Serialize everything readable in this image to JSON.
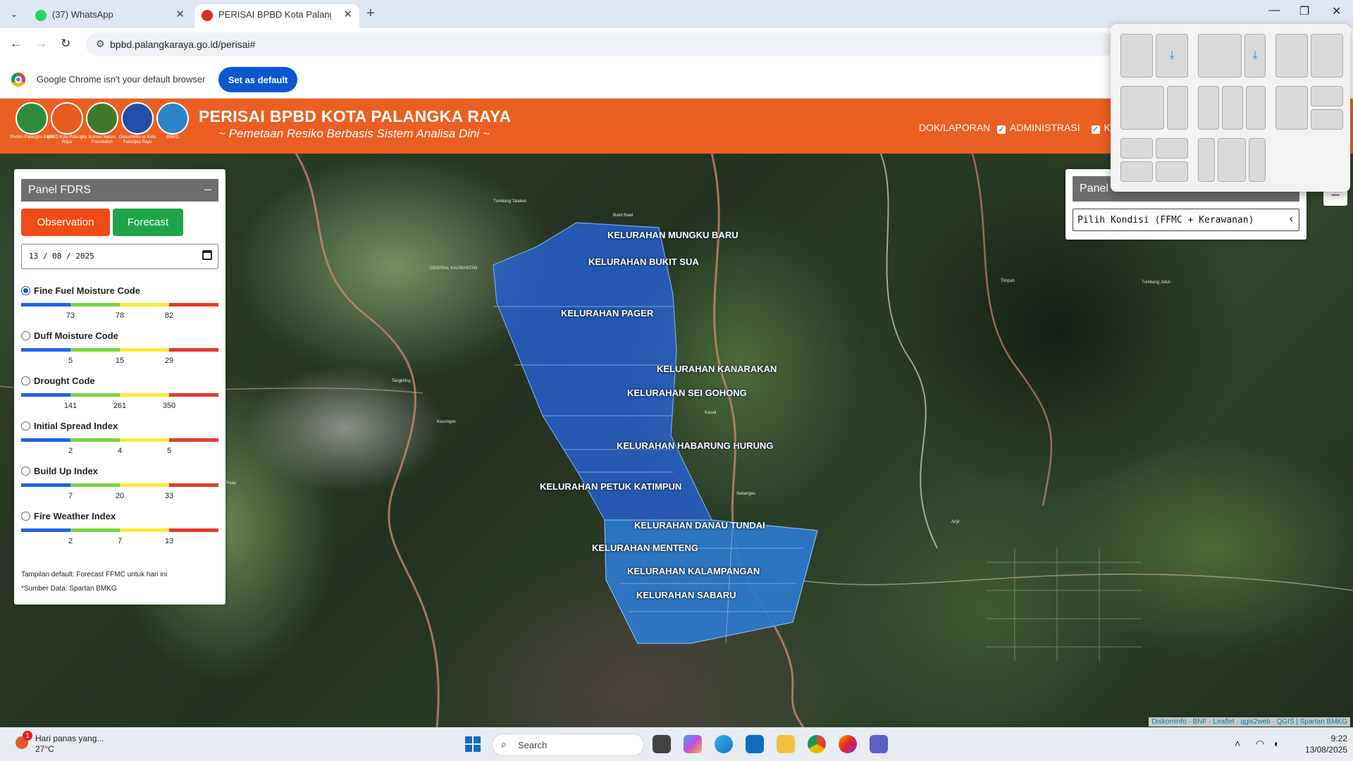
{
  "browser": {
    "tabs": [
      {
        "title": "(37) WhatsApp",
        "active": false
      },
      {
        "title": "PERISAI BPBD Kota Palangka Ra",
        "active": true
      }
    ],
    "url": "bpbd.palangkaraya.go.id/perisai#",
    "infobar": {
      "message": "Google Chrome isn't your default browser",
      "button": "Set as default"
    }
  },
  "header": {
    "title": "PERISAI BPBD KOTA PALANGKA RAYA",
    "subtitle": "~ Pemetaan Resiko Berbasis Sistem Analisa Dini ~",
    "logos": [
      {
        "caption": "Pemko Palangka Raya",
        "color": "#2e8b3e"
      },
      {
        "caption": "BPBD Kota Palangka Raya",
        "color": "#e65a1e"
      },
      {
        "caption": "Borneo Nature Foundation",
        "color": "#3f7a2a"
      },
      {
        "caption": "Diskominfo-sp Kota Palangka Raya",
        "color": "#1f4fa8"
      },
      {
        "caption": "BMKG",
        "color": "#2a86c8"
      }
    ],
    "nav": {
      "dok": "DOK/LAPORAN",
      "admin": "ADMINISTRASI",
      "third": "KA"
    }
  },
  "fdrs": {
    "title": "Panel FDRS",
    "minimize": "–",
    "observation": "Observation",
    "forecast": "Forecast",
    "date": "13 / 08 / 2025",
    "indices": [
      {
        "name": "Fine Fuel Moisture Code",
        "selected": true,
        "ticks": [
          "73",
          "78",
          "82"
        ]
      },
      {
        "name": "Duff Moisture Code",
        "selected": false,
        "ticks": [
          "5",
          "15",
          "29"
        ]
      },
      {
        "name": "Drought Code",
        "selected": false,
        "ticks": [
          "141",
          "261",
          "350"
        ]
      },
      {
        "name": "Initial Spread Index",
        "selected": false,
        "ticks": [
          "2",
          "4",
          "5"
        ]
      },
      {
        "name": "Build Up Index",
        "selected": false,
        "ticks": [
          "7",
          "20",
          "33"
        ]
      },
      {
        "name": "Fire Weather Index",
        "selected": false,
        "ticks": [
          "2",
          "7",
          "13"
        ]
      }
    ],
    "scale_colors": [
      "#1e64e6",
      "#7bd33c",
      "#f6ec3a",
      "#e23b2a"
    ],
    "note1": "Tampilan default: Forecast FFMC untuk hari ini",
    "note2": "*Sumber Data: Spartan BMKG"
  },
  "right_panel": {
    "title": "Panel",
    "select": "Pilih Kondisi (FFMC + Kerawanan)",
    "minimize": "–"
  },
  "map": {
    "kelurahan": [
      "KELURAHAN MUNGKU BARU",
      "KELURAHAN BUKIT SUA",
      "KELURAHAN PAGER",
      "KELURAHAN KANARAKAN",
      "KELURAHAN SEI GOHONG",
      "KELURAHAN HABARUNG HURUNG",
      "KELURAHAN PETUK KATIMPUN",
      "KELURAHAN DANAU TUNDAI",
      "KELURAHAN MENTENG",
      "KELURAHAN KALAMPANGAN",
      "KELURAHAN SABARU"
    ],
    "places": [
      "CENTRAL KALIMANTAN",
      "Tangkiling",
      "Kasongan",
      "Tumbang Talaken",
      "Pulang Pisau",
      "Timpah",
      "Anjir",
      "Sebangau",
      "Kasali",
      "Tumbang Jutuh",
      "Bukit Rawi"
    ],
    "attribution": "Diskominfo - BNF - Leaflet · qgis2web · QGIS | Spartan BMKG"
  },
  "taskbar": {
    "weather_title": "Hari panas yang...",
    "weather_temp": "27°C",
    "weather_badge": "1",
    "search": "Search",
    "time": "9:22",
    "date": "13/08/2025"
  }
}
